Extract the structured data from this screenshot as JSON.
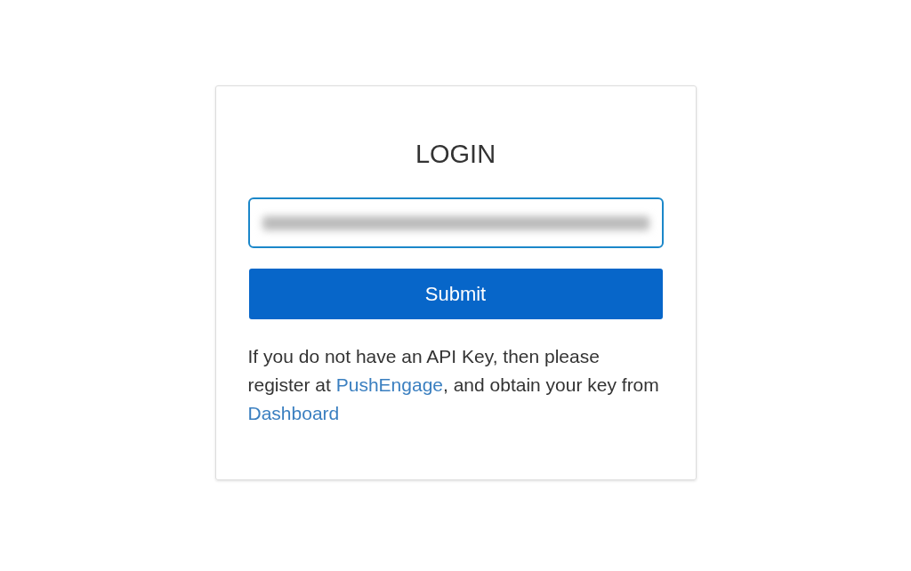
{
  "login_card": {
    "title": "LOGIN",
    "api_key_field": {
      "focused": true,
      "value_redacted": true
    },
    "submit_button": {
      "label": "Submit"
    },
    "help_text": [
      {
        "kind": "text",
        "text": "If you do not have an API Key, then please register at "
      },
      {
        "kind": "link",
        "text": "PushEngage"
      },
      {
        "kind": "text",
        "text": ", and obtain your key from "
      },
      {
        "kind": "link",
        "text": "Dashboard"
      }
    ]
  }
}
